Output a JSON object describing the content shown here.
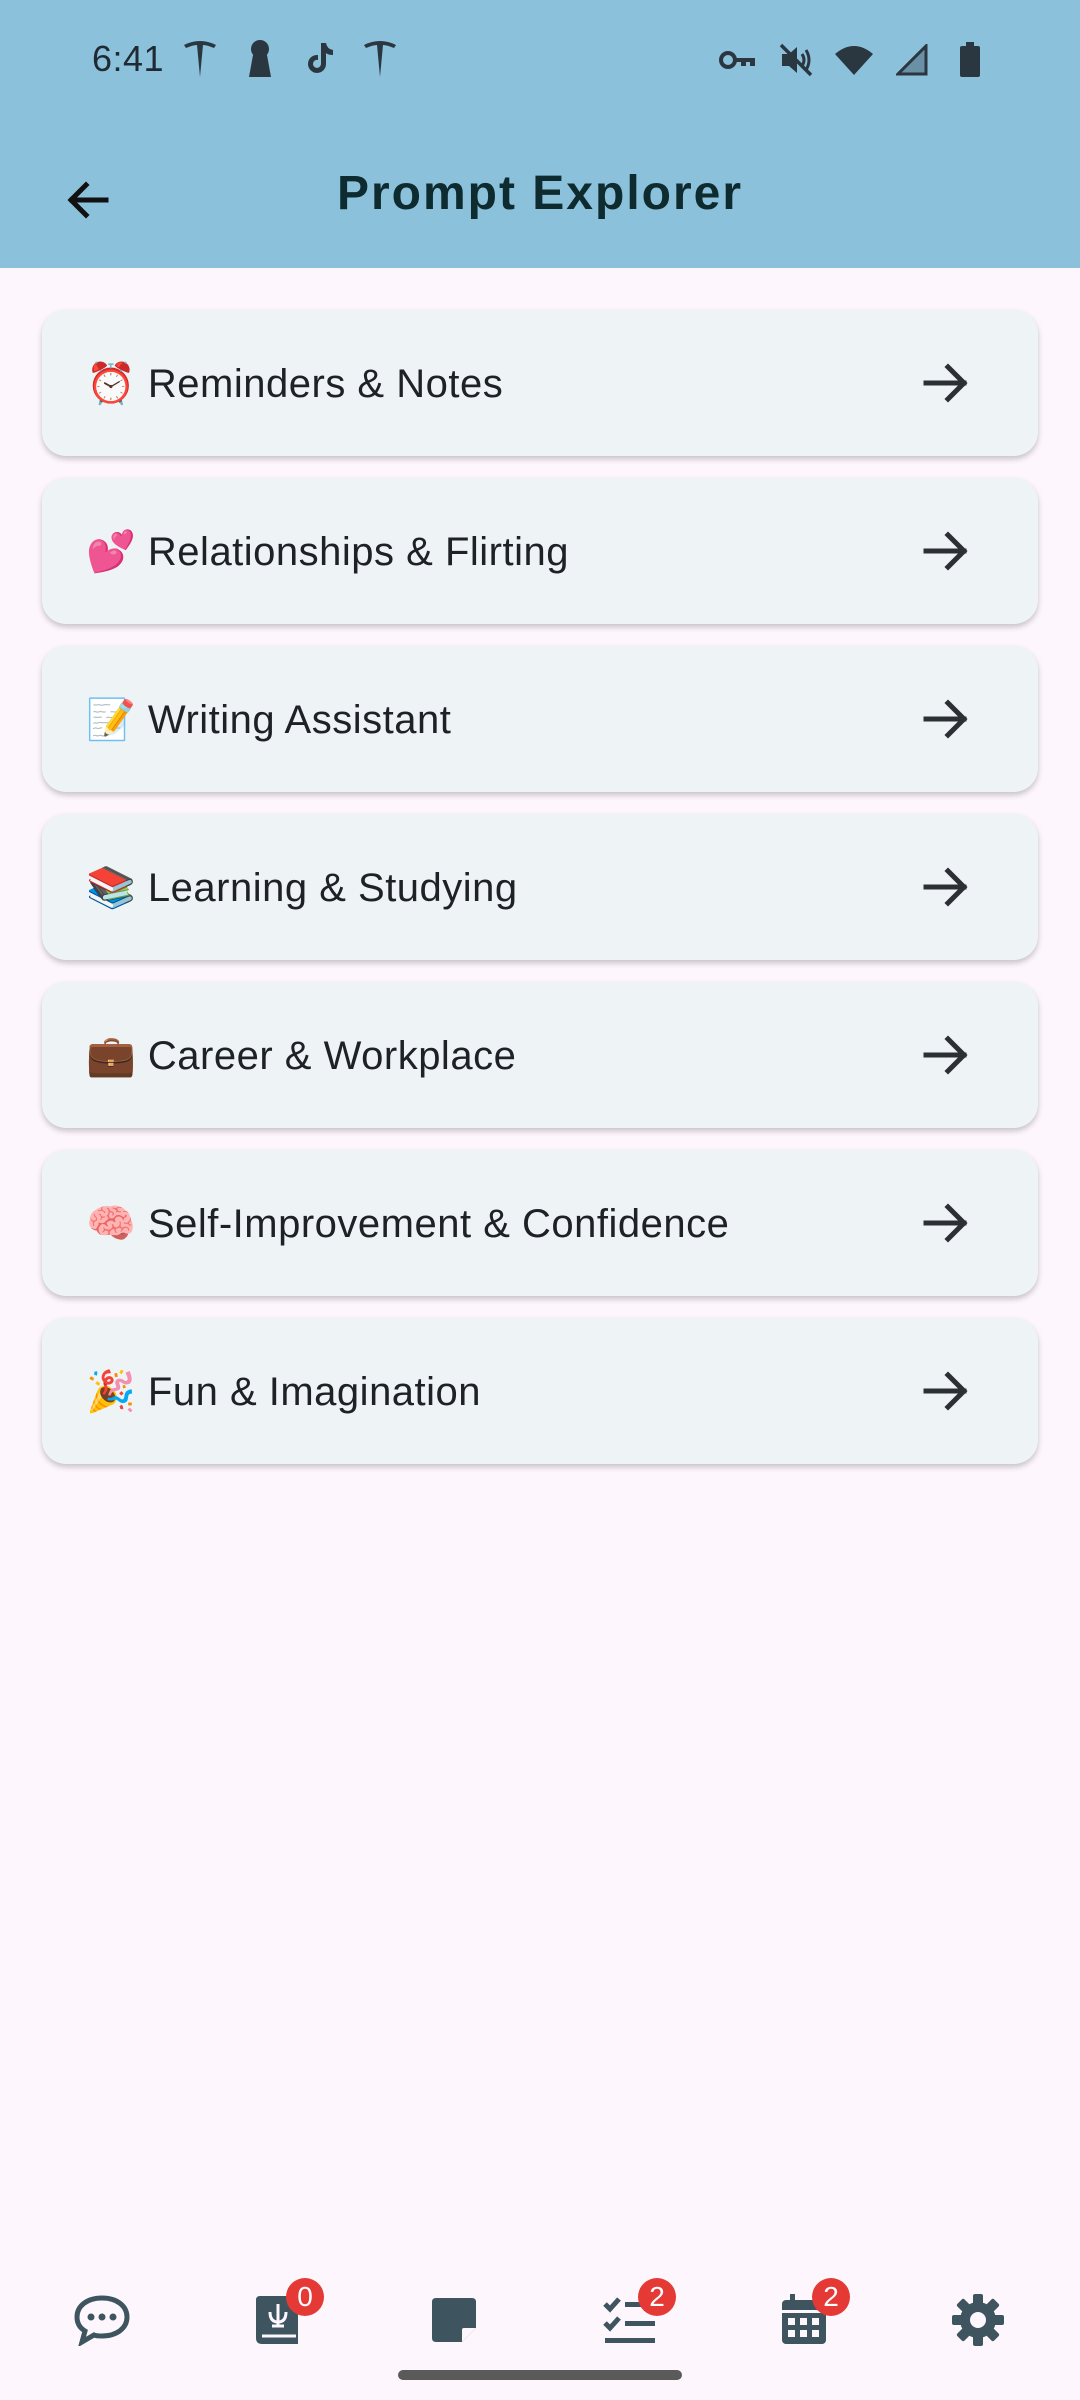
{
  "status_bar": {
    "time": "6:41",
    "left_icons": [
      "tesla-icon",
      "keyhole-icon",
      "tiktok-icon",
      "tesla-icon"
    ],
    "right_icons": [
      "vpn-key-icon",
      "mute-icon",
      "wifi-icon",
      "signal-icon",
      "battery-icon"
    ]
  },
  "header": {
    "title": "Prompt Explorer",
    "background_color": "#8BC1DA"
  },
  "categories": [
    {
      "label": "⏰ Reminders & Notes"
    },
    {
      "label": "💕 Relationships & Flirting"
    },
    {
      "label": "📝 Writing Assistant"
    },
    {
      "label": "📚 Learning & Studying"
    },
    {
      "label": "💼 Career & Workplace"
    },
    {
      "label": "🧠 Self-Improvement & Confidence"
    },
    {
      "label": "🎉 Fun & Imagination"
    }
  ],
  "bottom_nav": {
    "items": [
      {
        "icon": "chat-icon",
        "badge": ""
      },
      {
        "icon": "journal-icon",
        "badge": "0"
      },
      {
        "icon": "note-icon",
        "badge": ""
      },
      {
        "icon": "checklist-icon",
        "badge": "2"
      },
      {
        "icon": "calendar-icon",
        "badge": "2"
      },
      {
        "icon": "settings-icon",
        "badge": ""
      }
    ]
  },
  "colors": {
    "page_background": "#FDF7FD",
    "card_background": "#EEF3F6",
    "badge": "#E53935",
    "nav_icon": "#3E5560"
  }
}
